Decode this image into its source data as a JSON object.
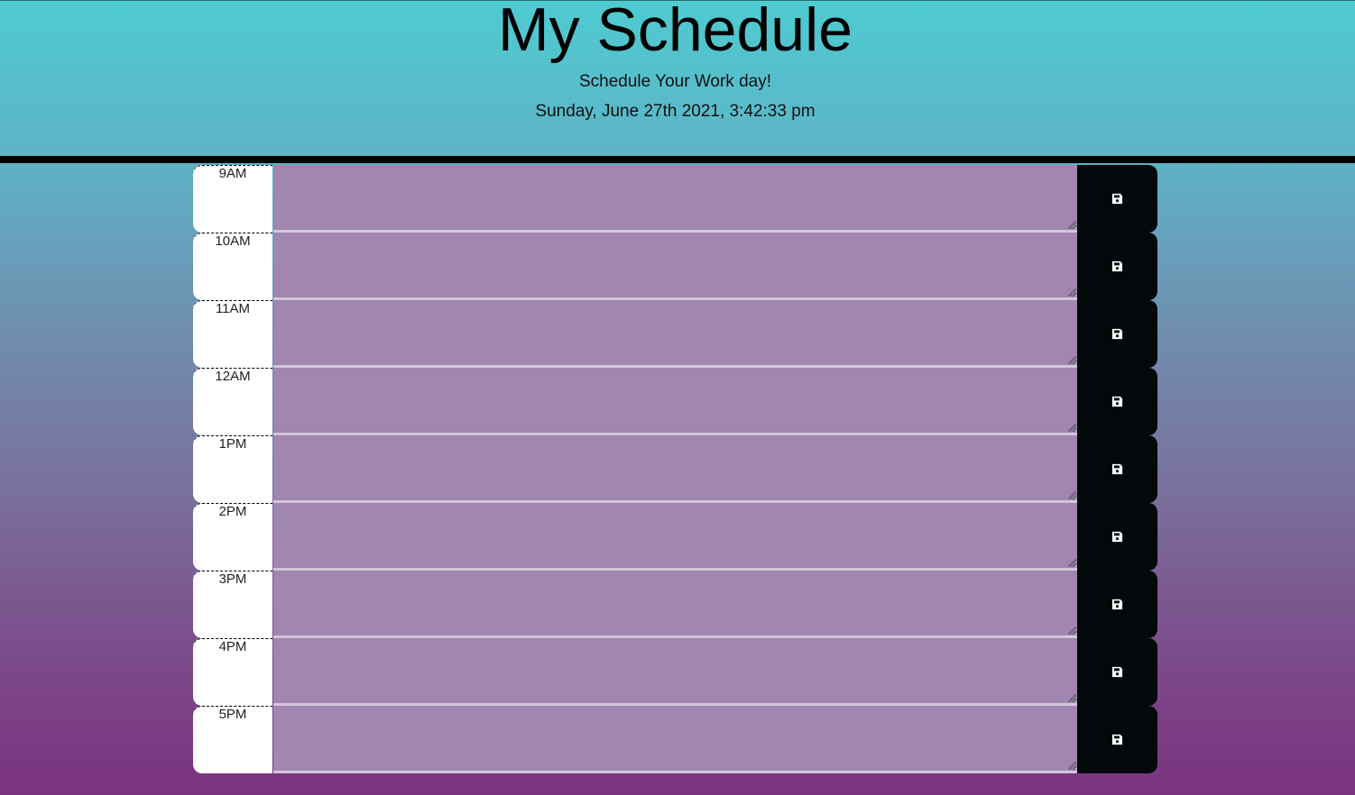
{
  "header": {
    "title": "My Schedule",
    "subtitle": "Schedule Your Work day!",
    "datetime": "Sunday, June 27th 2021, 3:42:33 pm"
  },
  "colors": {
    "gradient_top": "#4ecbd1",
    "gradient_bottom": "#7b3380",
    "entry_background": "#a086b0",
    "save_button": "#03080a",
    "hour_cell": "#ffffff"
  },
  "rows": [
    {
      "hour": "9AM",
      "entry": "",
      "save_icon": "floppy-disk-icon"
    },
    {
      "hour": "10AM",
      "entry": "",
      "save_icon": "floppy-disk-icon"
    },
    {
      "hour": "11AM",
      "entry": "",
      "save_icon": "floppy-disk-icon"
    },
    {
      "hour": "12AM",
      "entry": "",
      "save_icon": "floppy-disk-icon"
    },
    {
      "hour": "1PM",
      "entry": "",
      "save_icon": "floppy-disk-icon"
    },
    {
      "hour": "2PM",
      "entry": "",
      "save_icon": "floppy-disk-icon"
    },
    {
      "hour": "3PM",
      "entry": "",
      "save_icon": "floppy-disk-icon"
    },
    {
      "hour": "4PM",
      "entry": "",
      "save_icon": "floppy-disk-icon"
    },
    {
      "hour": "5PM",
      "entry": "",
      "save_icon": "floppy-disk-icon"
    }
  ]
}
